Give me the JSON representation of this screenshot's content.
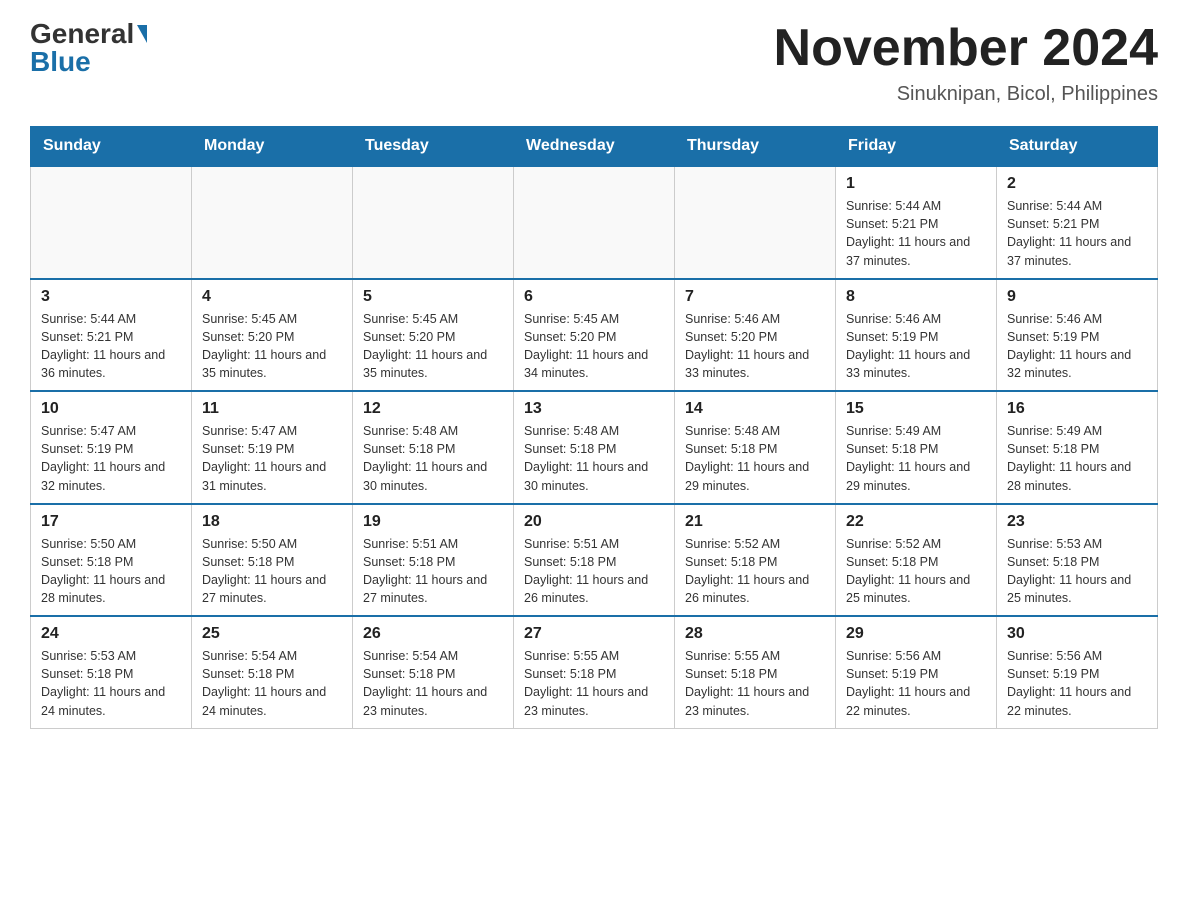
{
  "logo": {
    "general": "General",
    "blue": "Blue"
  },
  "title": "November 2024",
  "subtitle": "Sinuknipan, Bicol, Philippines",
  "days_of_week": [
    "Sunday",
    "Monday",
    "Tuesday",
    "Wednesday",
    "Thursday",
    "Friday",
    "Saturday"
  ],
  "weeks": [
    [
      {
        "day": "",
        "info": ""
      },
      {
        "day": "",
        "info": ""
      },
      {
        "day": "",
        "info": ""
      },
      {
        "day": "",
        "info": ""
      },
      {
        "day": "",
        "info": ""
      },
      {
        "day": "1",
        "info": "Sunrise: 5:44 AM\nSunset: 5:21 PM\nDaylight: 11 hours and 37 minutes."
      },
      {
        "day": "2",
        "info": "Sunrise: 5:44 AM\nSunset: 5:21 PM\nDaylight: 11 hours and 37 minutes."
      }
    ],
    [
      {
        "day": "3",
        "info": "Sunrise: 5:44 AM\nSunset: 5:21 PM\nDaylight: 11 hours and 36 minutes."
      },
      {
        "day": "4",
        "info": "Sunrise: 5:45 AM\nSunset: 5:20 PM\nDaylight: 11 hours and 35 minutes."
      },
      {
        "day": "5",
        "info": "Sunrise: 5:45 AM\nSunset: 5:20 PM\nDaylight: 11 hours and 35 minutes."
      },
      {
        "day": "6",
        "info": "Sunrise: 5:45 AM\nSunset: 5:20 PM\nDaylight: 11 hours and 34 minutes."
      },
      {
        "day": "7",
        "info": "Sunrise: 5:46 AM\nSunset: 5:20 PM\nDaylight: 11 hours and 33 minutes."
      },
      {
        "day": "8",
        "info": "Sunrise: 5:46 AM\nSunset: 5:19 PM\nDaylight: 11 hours and 33 minutes."
      },
      {
        "day": "9",
        "info": "Sunrise: 5:46 AM\nSunset: 5:19 PM\nDaylight: 11 hours and 32 minutes."
      }
    ],
    [
      {
        "day": "10",
        "info": "Sunrise: 5:47 AM\nSunset: 5:19 PM\nDaylight: 11 hours and 32 minutes."
      },
      {
        "day": "11",
        "info": "Sunrise: 5:47 AM\nSunset: 5:19 PM\nDaylight: 11 hours and 31 minutes."
      },
      {
        "day": "12",
        "info": "Sunrise: 5:48 AM\nSunset: 5:18 PM\nDaylight: 11 hours and 30 minutes."
      },
      {
        "day": "13",
        "info": "Sunrise: 5:48 AM\nSunset: 5:18 PM\nDaylight: 11 hours and 30 minutes."
      },
      {
        "day": "14",
        "info": "Sunrise: 5:48 AM\nSunset: 5:18 PM\nDaylight: 11 hours and 29 minutes."
      },
      {
        "day": "15",
        "info": "Sunrise: 5:49 AM\nSunset: 5:18 PM\nDaylight: 11 hours and 29 minutes."
      },
      {
        "day": "16",
        "info": "Sunrise: 5:49 AM\nSunset: 5:18 PM\nDaylight: 11 hours and 28 minutes."
      }
    ],
    [
      {
        "day": "17",
        "info": "Sunrise: 5:50 AM\nSunset: 5:18 PM\nDaylight: 11 hours and 28 minutes."
      },
      {
        "day": "18",
        "info": "Sunrise: 5:50 AM\nSunset: 5:18 PM\nDaylight: 11 hours and 27 minutes."
      },
      {
        "day": "19",
        "info": "Sunrise: 5:51 AM\nSunset: 5:18 PM\nDaylight: 11 hours and 27 minutes."
      },
      {
        "day": "20",
        "info": "Sunrise: 5:51 AM\nSunset: 5:18 PM\nDaylight: 11 hours and 26 minutes."
      },
      {
        "day": "21",
        "info": "Sunrise: 5:52 AM\nSunset: 5:18 PM\nDaylight: 11 hours and 26 minutes."
      },
      {
        "day": "22",
        "info": "Sunrise: 5:52 AM\nSunset: 5:18 PM\nDaylight: 11 hours and 25 minutes."
      },
      {
        "day": "23",
        "info": "Sunrise: 5:53 AM\nSunset: 5:18 PM\nDaylight: 11 hours and 25 minutes."
      }
    ],
    [
      {
        "day": "24",
        "info": "Sunrise: 5:53 AM\nSunset: 5:18 PM\nDaylight: 11 hours and 24 minutes."
      },
      {
        "day": "25",
        "info": "Sunrise: 5:54 AM\nSunset: 5:18 PM\nDaylight: 11 hours and 24 minutes."
      },
      {
        "day": "26",
        "info": "Sunrise: 5:54 AM\nSunset: 5:18 PM\nDaylight: 11 hours and 23 minutes."
      },
      {
        "day": "27",
        "info": "Sunrise: 5:55 AM\nSunset: 5:18 PM\nDaylight: 11 hours and 23 minutes."
      },
      {
        "day": "28",
        "info": "Sunrise: 5:55 AM\nSunset: 5:18 PM\nDaylight: 11 hours and 23 minutes."
      },
      {
        "day": "29",
        "info": "Sunrise: 5:56 AM\nSunset: 5:19 PM\nDaylight: 11 hours and 22 minutes."
      },
      {
        "day": "30",
        "info": "Sunrise: 5:56 AM\nSunset: 5:19 PM\nDaylight: 11 hours and 22 minutes."
      }
    ]
  ]
}
